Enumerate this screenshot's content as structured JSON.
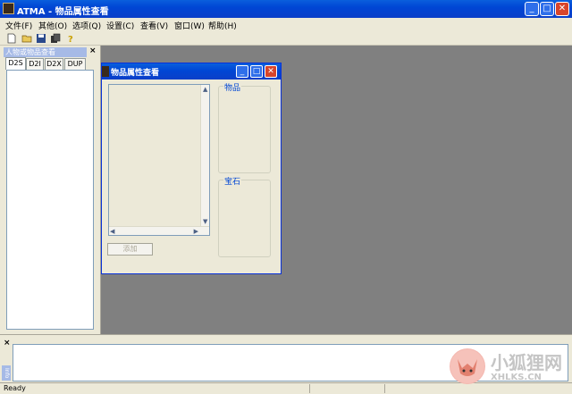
{
  "app": {
    "title": "ATMA - 物品属性查看"
  },
  "window_buttons": {
    "minimize": "_",
    "maximize": "□",
    "close": "✕"
  },
  "menu": [
    {
      "label": "文件(F)"
    },
    {
      "label": "其他(O)"
    },
    {
      "label": "选项(Q)"
    },
    {
      "label": "设置(C)"
    },
    {
      "label": "查看(V)"
    },
    {
      "label": "窗口(W)"
    },
    {
      "label": "帮助(H)"
    }
  ],
  "toolbar": {
    "icons": [
      "new-file-icon",
      "open-folder-icon",
      "save-icon",
      "copy-icon",
      "help-icon"
    ]
  },
  "left_panel": {
    "title": "人物或物品查看",
    "close": "×",
    "tabs": [
      {
        "label": "D2S"
      },
      {
        "label": "D2I"
      },
      {
        "label": "D2X"
      },
      {
        "label": "DUP"
      }
    ],
    "active_tab": "D2S"
  },
  "child_window": {
    "title": "物品属性查看",
    "item_group": "物品",
    "gem_group": "宝石",
    "add_button": "添加"
  },
  "bottom_panel": {
    "close": "×",
    "caption": "Info"
  },
  "status": {
    "text": "Ready"
  },
  "watermark": {
    "text": "小狐狸网",
    "url": "XHLKS.CN"
  },
  "colors": {
    "titlebar": "#0A3FC8",
    "workspace": "#808080",
    "face": "#ECE9D8",
    "close_button": "#D8452B",
    "group_label": "#0046D5"
  }
}
